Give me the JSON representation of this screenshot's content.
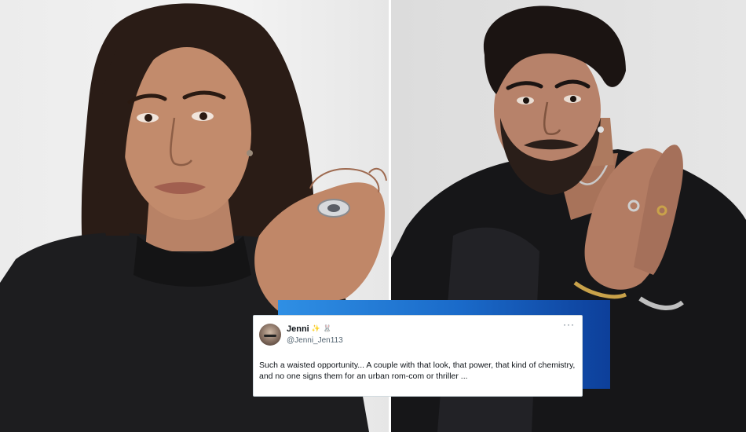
{
  "photos": {
    "left": {
      "subject": "woman-in-black-top"
    },
    "right": {
      "subject": "man-in-black-velvet-shirt"
    }
  },
  "tweet": {
    "display_name": "Jenni",
    "emoji_1": "✨",
    "emoji_2": "🐰",
    "handle": "@Jenni_Jen113",
    "more_label": "···",
    "text": "Such a waisted opportunity... A couple with that look, that power, that kind of chemistry, and no one signs them for an urban rom-com or thriller ..."
  },
  "colors": {
    "accent_blue": "#1a6ac9",
    "tweet_text": "#0f1419",
    "tweet_muted": "#536471"
  }
}
